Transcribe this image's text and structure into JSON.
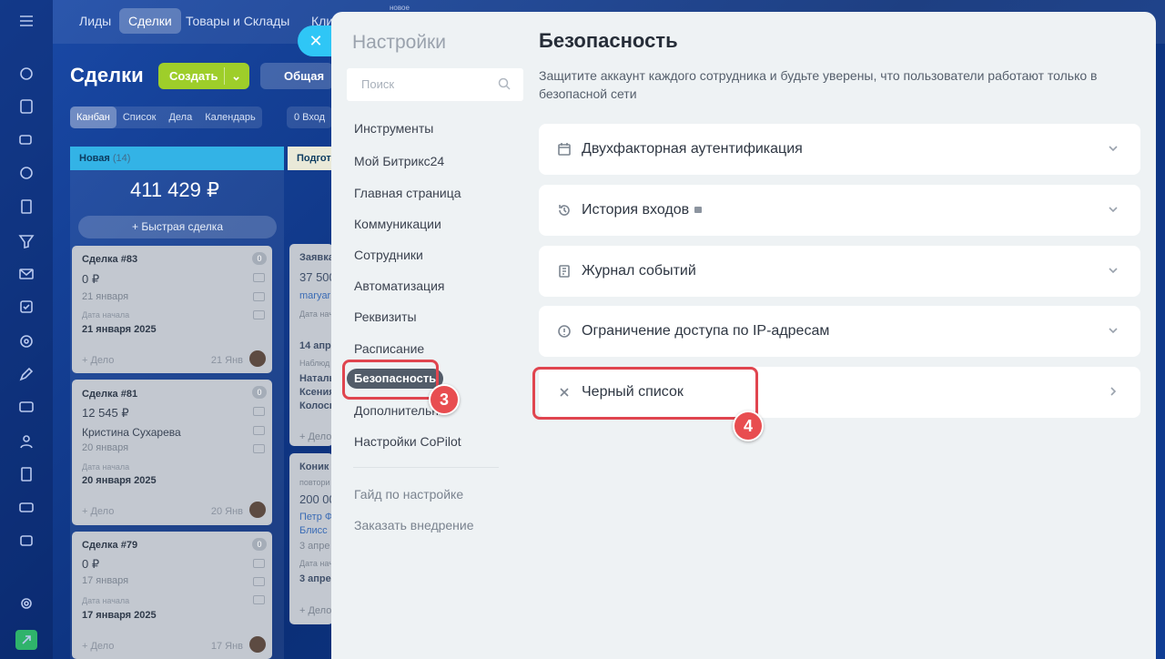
{
  "topnav": {
    "items": [
      "Лиды",
      "Сделки",
      "Товары и Склады",
      "Кли"
    ],
    "active": "Сделки",
    "top_label": "новое"
  },
  "crm": {
    "title": "Сделки",
    "create": "Создать",
    "filter": "Общая",
    "views": [
      "Канбан",
      "Список",
      "Дела",
      "Календарь"
    ],
    "chip": "0 Вход",
    "column1": {
      "name": "Новая",
      "count": "(14)",
      "sum": "411 429 ₽",
      "quick": "Быстрая сделка"
    },
    "column2": {
      "name": "Подгото"
    },
    "cards": [
      {
        "title": "Сделка #83",
        "price": "0 ₽",
        "sub": "21 января",
        "date_label": "Дата начала",
        "date": "21 января 2025",
        "add": "+ Дело",
        "day": "21 Янв",
        "badge": "0"
      },
      {
        "title": "Сделка #81",
        "price": "12 545 ₽",
        "sub": "Кристина Сухарева",
        "sub2": "20 января",
        "date_label": "Дата начала",
        "date": "20 января 2025",
        "add": "+ Дело",
        "day": "20 Янв",
        "badge": "0"
      },
      {
        "title": "Сделка #79",
        "price": "0 ₽",
        "sub": "17 января",
        "date_label": "Дата начала",
        "date": "17 января 2025",
        "add": "+ Дело",
        "day": "17 Янв",
        "badge": "0"
      }
    ],
    "cards2": [
      {
        "lines": [
          "Заявка",
          "37 500",
          "maryar",
          "Дата нач",
          "14 апре",
          "Наблюд",
          "Натальi",
          "Ксения",
          "Колосн",
          "+ Дело"
        ]
      },
      {
        "lines": [
          "Коник",
          "повтори",
          "200 00",
          "Петр Ф",
          "Блисс",
          "3 апре",
          "Дата нач",
          "3 апре",
          "+ Дело"
        ]
      }
    ]
  },
  "settings": {
    "title": "Настройки",
    "search_placeholder": "Поиск",
    "menu": [
      "Инструменты",
      "Мой Битрикс24",
      "Главная страница",
      "Коммуникации",
      "Сотрудники",
      "Автоматизация",
      "Реквизиты",
      "Расписание",
      "Безопасность",
      "Дополнительно",
      "Настройки CoPilot"
    ],
    "links": [
      "Гайд по настройке",
      "Заказать внедрение"
    ]
  },
  "security": {
    "title": "Безопасность",
    "description": "Защитите аккаунт каждого сотрудника и будьте уверены, что пользователи работают только в безопасной сети",
    "rows": [
      {
        "label": "Двухфакторная аутентификация",
        "icon": "calendar-icon"
      },
      {
        "label": "История входов",
        "icon": "history-icon"
      },
      {
        "label": "Журнал событий",
        "icon": "journal-icon"
      },
      {
        "label": "Ограничение доступа по IP-адресам",
        "icon": "info-icon"
      },
      {
        "label": "Черный список",
        "icon": "close-icon"
      }
    ]
  },
  "badges": {
    "step3": "3",
    "step4": "4"
  },
  "colors": {
    "accent": "#e84d50",
    "active_menu": "#525c69",
    "close_btn": "#2fc6f6"
  }
}
